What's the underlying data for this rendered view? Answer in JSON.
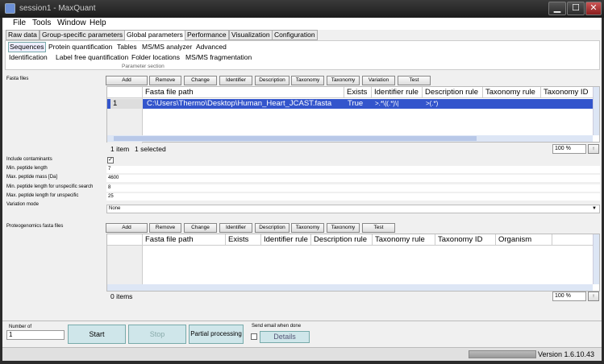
{
  "window": {
    "title": "session1 - MaxQuant",
    "min": "▁",
    "max": "☐",
    "close": "✕"
  },
  "menu": [
    "File",
    "Tools",
    "Window",
    "Help"
  ],
  "tabs": [
    "Raw data",
    "Group-specific parameters",
    "Global parameters",
    "Performance",
    "Visualization",
    "Configuration"
  ],
  "subtabs_row1": [
    "Sequences",
    "Protein quantification",
    "Tables",
    "MS/MS analyzer",
    "Advanced"
  ],
  "subtabs_row2": [
    "Identification",
    "Label free quantification",
    "Folder locations",
    "MS/MS fragmentation"
  ],
  "parameter_section": "Parameter section",
  "fasta": {
    "label": "Fasta files",
    "buttons": [
      "Add",
      "Remove",
      "Change",
      "Identifier",
      "Description",
      "Taxonomy",
      "Taxonomy",
      "Variation",
      "Test"
    ],
    "columns": [
      "Fasta file path",
      "Exists",
      "Identifier rule",
      "Description rule",
      "Taxonomy rule",
      "Taxonomy ID"
    ],
    "row": {
      "index": "1",
      "path": "C:\\Users\\Thermo\\Desktop\\Human_Heart_JCAST.fasta",
      "exists": "True",
      "identifier_rule": ">.*\\|(.*)\\|",
      "description_rule": ">(.*)"
    },
    "status_items": "1 item",
    "status_selected": "1 selected",
    "zoom": "100 %"
  },
  "params": [
    {
      "label": "Include contaminants",
      "value": "✓"
    },
    {
      "label": "Min. peptide length",
      "value": "7"
    },
    {
      "label": "Max. peptide mass [Da]",
      "value": "4600"
    },
    {
      "label": "Min. peptide length for unspecific search",
      "value": "8"
    },
    {
      "label": "Max. peptide length for unspecific",
      "value": "25"
    },
    {
      "label": "Variation mode",
      "value": "None"
    }
  ],
  "proteo": {
    "label": "Proteogenomics fasta files",
    "buttons": [
      "Add",
      "Remove",
      "Change",
      "Identifier",
      "Description",
      "Taxonomy",
      "Taxonomy",
      "Test"
    ],
    "columns": [
      "Fasta file path",
      "Exists",
      "Identifier rule",
      "Description rule",
      "Taxonomy rule",
      "Taxonomy ID",
      "Organism"
    ],
    "status_items": "0 items",
    "zoom": "100 %"
  },
  "bottom": {
    "number_of_label": "Number of",
    "number_value": "1",
    "start": "Start",
    "stop": "Stop",
    "partial": "Partial processing",
    "email_label": "Send email when done",
    "details": "Details"
  },
  "status": {
    "version": "Version 1.6.10.43"
  }
}
